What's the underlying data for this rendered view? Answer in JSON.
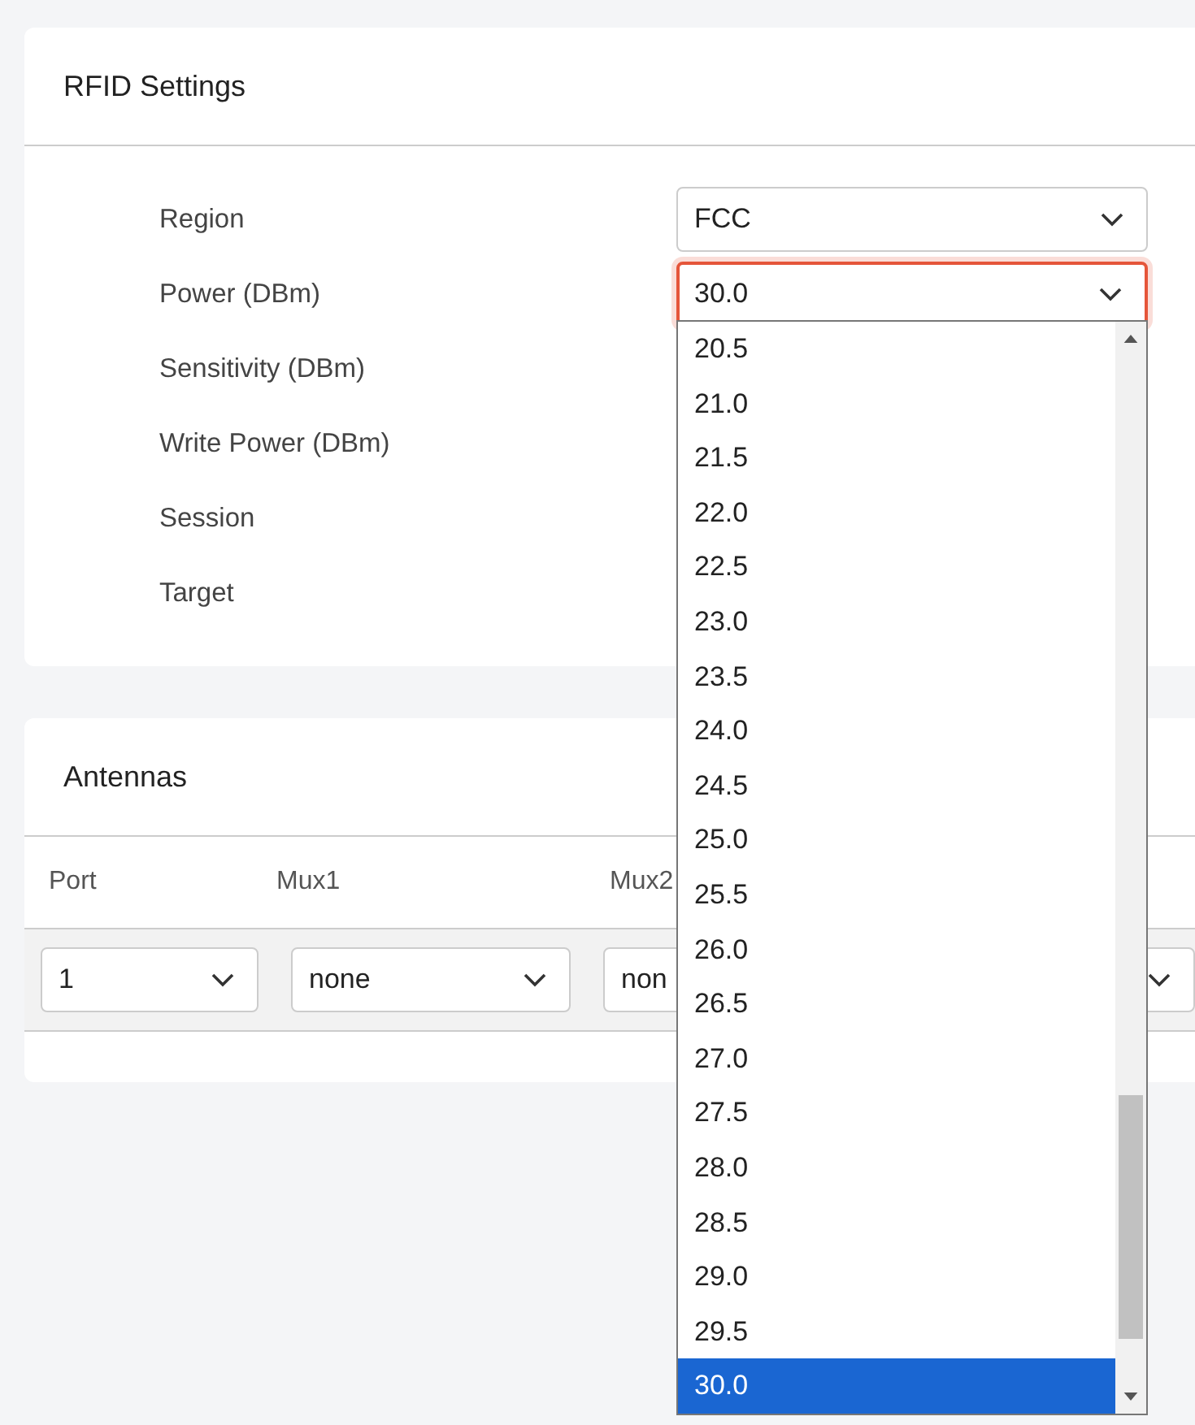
{
  "rfid_settings": {
    "title": "RFID Settings",
    "fields": [
      {
        "label": "Region",
        "value": "FCC",
        "focused": false
      },
      {
        "label": "Power (DBm)",
        "value": "30.0",
        "focused": true
      },
      {
        "label": "Sensitivity (DBm)"
      },
      {
        "label": "Write Power (DBm)"
      },
      {
        "label": "Session"
      },
      {
        "label": "Target"
      }
    ]
  },
  "antennas": {
    "title": "Antennas",
    "columns": [
      "Port",
      "Mux1",
      "Mux2"
    ],
    "row": [
      {
        "kind": "select",
        "value": "1"
      },
      {
        "kind": "select",
        "value": "none"
      },
      {
        "kind": "select-covered",
        "value": "non"
      },
      {
        "kind": "select"
      }
    ]
  },
  "power_dropdown": {
    "options": [
      {
        "label": "20.5",
        "selected": false
      },
      {
        "label": "21.0",
        "selected": false
      },
      {
        "label": "21.5",
        "selected": false
      },
      {
        "label": "22.0",
        "selected": false
      },
      {
        "label": "22.5",
        "selected": false
      },
      {
        "label": "23.0",
        "selected": false
      },
      {
        "label": "23.5",
        "selected": false
      },
      {
        "label": "24.0",
        "selected": false
      },
      {
        "label": "24.5",
        "selected": false
      },
      {
        "label": "25.0",
        "selected": false
      },
      {
        "label": "25.5",
        "selected": false
      },
      {
        "label": "26.0",
        "selected": false
      },
      {
        "label": "26.5",
        "selected": false
      },
      {
        "label": "27.0",
        "selected": false
      },
      {
        "label": "27.5",
        "selected": false
      },
      {
        "label": "28.0",
        "selected": false
      },
      {
        "label": "28.5",
        "selected": false
      },
      {
        "label": "29.0",
        "selected": false
      },
      {
        "label": "29.5",
        "selected": false
      },
      {
        "label": "30.0",
        "selected": true
      }
    ]
  }
}
